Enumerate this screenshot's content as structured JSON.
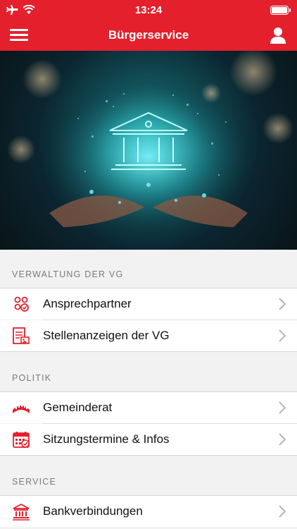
{
  "status_bar": {
    "time": "13:24"
  },
  "nav": {
    "title": "Bürgerservice"
  },
  "sections": [
    {
      "header": "VERWALTUNG DER VG",
      "items": [
        {
          "label": "Ansprechpartner",
          "icon": "people-icon"
        },
        {
          "label": "Stellenanzeigen der VG",
          "icon": "job-posting-icon"
        }
      ]
    },
    {
      "header": "POLITIK",
      "items": [
        {
          "label": "Gemeinderat",
          "icon": "council-icon"
        },
        {
          "label": "Sitzungstermine & Infos",
          "icon": "calendar-icon"
        }
      ]
    },
    {
      "header": "SERVICE",
      "items": [
        {
          "label": "Bankverbindungen",
          "icon": "bank-icon"
        }
      ]
    }
  ],
  "colors": {
    "accent": "#e4202c",
    "icon_red": "#e4202c",
    "chevron": "#b5b5b5"
  }
}
